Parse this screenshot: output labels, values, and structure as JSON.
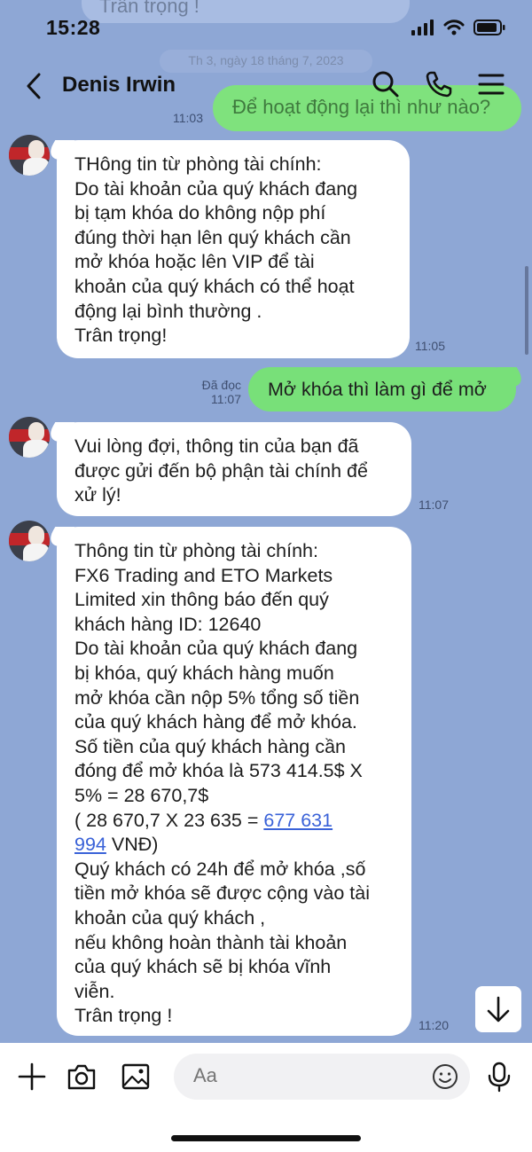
{
  "status_bar": {
    "time": "15:28"
  },
  "header": {
    "contact_name": "Denis Irwin"
  },
  "background_ghost": {
    "top_text": "Trân trọng !",
    "date_separator": "Th 3, ngày 18 tháng 7, 2023",
    "green_text": "Để hoạt động lại thì như nào?",
    "green_time": "11:03"
  },
  "messages": [
    {
      "direction": "in",
      "lines": [
        "THông tin từ phòng tài chính:",
        "Do tài khoản của quý khách đang",
        "bị tạm khóa do không nộp phí",
        "đúng thời hạn lên quý khách cần",
        "mở khóa hoặc lên VIP để tài",
        "khoản của quý khách có thể hoạt",
        "động lại bình thường .",
        "Trân trọng!"
      ],
      "time": "11:05"
    },
    {
      "direction": "out",
      "text": "Mở khóa thì làm gì để mở",
      "read_label": "Đã đọc",
      "time": "11:07"
    },
    {
      "direction": "in",
      "lines": [
        "Vui lòng đợi, thông tin của bạn đã",
        "được gửi đến bộ phận tài chính để",
        "xử lý!"
      ],
      "time": "11:07"
    },
    {
      "direction": "in",
      "lines_before_link": [
        "Thông tin từ phòng tài chính:",
        "FX6 Trading and ETO Markets",
        "Limited xin thông báo đến quý",
        "khách hàng ID: 12640",
        "Do tài khoản của quý khách đang",
        "bị khóa, quý khách hàng muốn",
        "mở khóa cần nộp 5% tổng số tiền",
        "của quý khách hàng để mở khóa.",
        "Số tiền của quý khách hàng cần",
        "đóng để mở khóa là 573 414.5$ X",
        "5% = 28 670,7$"
      ],
      "link_line_prefix": "( 28 670,7 X 23 635 = ",
      "link_part1": "677 631",
      "link_part2": "994",
      "link_line_suffix": " VNĐ)",
      "lines_after_link": [
        "Quý khách có 24h để mở khóa ,số",
        "tiền mở khóa sẽ được cộng vào tài",
        "khoản của quý khách ,",
        "nếu không hoàn thành tài khoản",
        "của quý khách sẽ bị khóa vĩnh",
        "viễn.",
        "Trân trọng !"
      ],
      "time": "11:20"
    }
  ],
  "composer": {
    "placeholder": "Aa"
  },
  "icons": [
    "back-chevron-icon",
    "search-icon",
    "phone-icon",
    "menu-icon",
    "plus-icon",
    "camera-icon",
    "image-icon",
    "emoji-icon",
    "microphone-icon",
    "arrow-down-icon"
  ]
}
